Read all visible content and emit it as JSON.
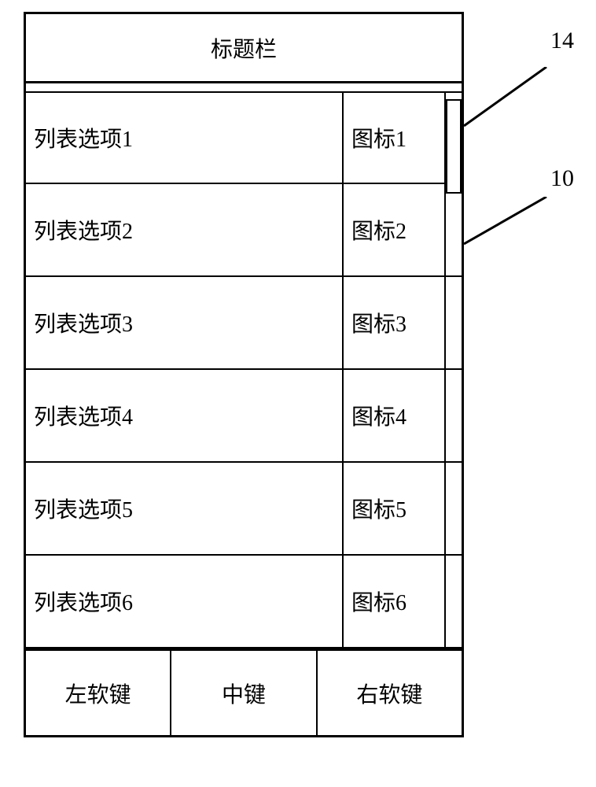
{
  "title": "标题栏",
  "listItems": [
    {
      "label": "列表选项1",
      "icon": "图标1"
    },
    {
      "label": "列表选项2",
      "icon": "图标2"
    },
    {
      "label": "列表选项3",
      "icon": "图标3"
    },
    {
      "label": "列表选项4",
      "icon": "图标4"
    },
    {
      "label": "列表选项5",
      "icon": "图标5"
    },
    {
      "label": "列表选项6",
      "icon": "图标6"
    }
  ],
  "softkeys": {
    "left": "左软键",
    "center": "中键",
    "right": "右软键"
  },
  "callouts": {
    "label14": "14",
    "label10": "10"
  }
}
